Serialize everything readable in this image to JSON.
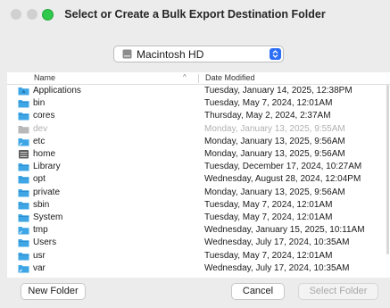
{
  "window": {
    "title": "Select or Create a Bulk Export Destination Folder"
  },
  "location_popup": {
    "value": "Macintosh HD",
    "icon": "hard-drive-icon"
  },
  "columns": {
    "name": "Name",
    "date": "Date Modified",
    "sort_indicator": "^"
  },
  "files": [
    {
      "name": "Applications",
      "date": "Tuesday, January 14, 2025, 12:38PM",
      "icon": "apps-folder-icon",
      "dimmed": false
    },
    {
      "name": "bin",
      "date": "Tuesday, May 7, 2024, 12:01AM",
      "icon": "folder-icon",
      "dimmed": false
    },
    {
      "name": "cores",
      "date": "Thursday, May 2, 2024, 2:37AM",
      "icon": "folder-icon",
      "dimmed": false
    },
    {
      "name": "dev",
      "date": "Monday, January 13, 2025, 9:55AM",
      "icon": "device-icon",
      "dimmed": true
    },
    {
      "name": "etc",
      "date": "Monday, January 13, 2025, 9:56AM",
      "icon": "folder-alias-icon",
      "dimmed": false
    },
    {
      "name": "home",
      "date": "Monday, January 13, 2025, 9:56AM",
      "icon": "server-icon",
      "dimmed": false
    },
    {
      "name": "Library",
      "date": "Tuesday, December 17, 2024, 10:27AM",
      "icon": "folder-icon",
      "dimmed": false
    },
    {
      "name": "opt",
      "date": "Wednesday, August 28, 2024, 12:04PM",
      "icon": "folder-icon",
      "dimmed": false
    },
    {
      "name": "private",
      "date": "Monday, January 13, 2025, 9:56AM",
      "icon": "folder-icon",
      "dimmed": false
    },
    {
      "name": "sbin",
      "date": "Tuesday, May 7, 2024, 12:01AM",
      "icon": "folder-icon",
      "dimmed": false
    },
    {
      "name": "System",
      "date": "Tuesday, May 7, 2024, 12:01AM",
      "icon": "folder-icon",
      "dimmed": false
    },
    {
      "name": "tmp",
      "date": "Wednesday, January 15, 2025, 10:11AM",
      "icon": "folder-alias-icon",
      "dimmed": false
    },
    {
      "name": "Users",
      "date": "Wednesday, July 17, 2024, 10:35AM",
      "icon": "folder-icon",
      "dimmed": false
    },
    {
      "name": "usr",
      "date": "Tuesday, May 7, 2024, 12:01AM",
      "icon": "folder-icon",
      "dimmed": false
    },
    {
      "name": "var",
      "date": "Wednesday, July 17, 2024, 10:35AM",
      "icon": "folder-alias-icon",
      "dimmed": false
    }
  ],
  "buttons": {
    "new_folder": "New Folder",
    "cancel": "Cancel",
    "select_folder": "Select Folder"
  },
  "colors": {
    "folder": "#3fa6e6",
    "accent": "#2d6ef7",
    "zoom_button": "#2fc84a"
  }
}
